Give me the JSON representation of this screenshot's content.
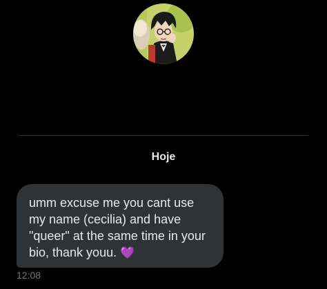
{
  "conversation": {
    "sender_name": "Hoje",
    "avatar_icon": "profile-avatar-illustration"
  },
  "message": {
    "text": "umm excuse me you cant use my name (cecilia) and have \"queer\" at the same time in your bio, thank youu. ",
    "emoji": "💜",
    "emoji_icon": "purple-heart-icon",
    "time": "12:08"
  },
  "colors": {
    "background": "#000000",
    "bubble": "#2f3336",
    "text": "#e7e9ea",
    "muted": "#71767b",
    "heart": "#9b59d0",
    "avatar_bg": "#c8d46a"
  }
}
